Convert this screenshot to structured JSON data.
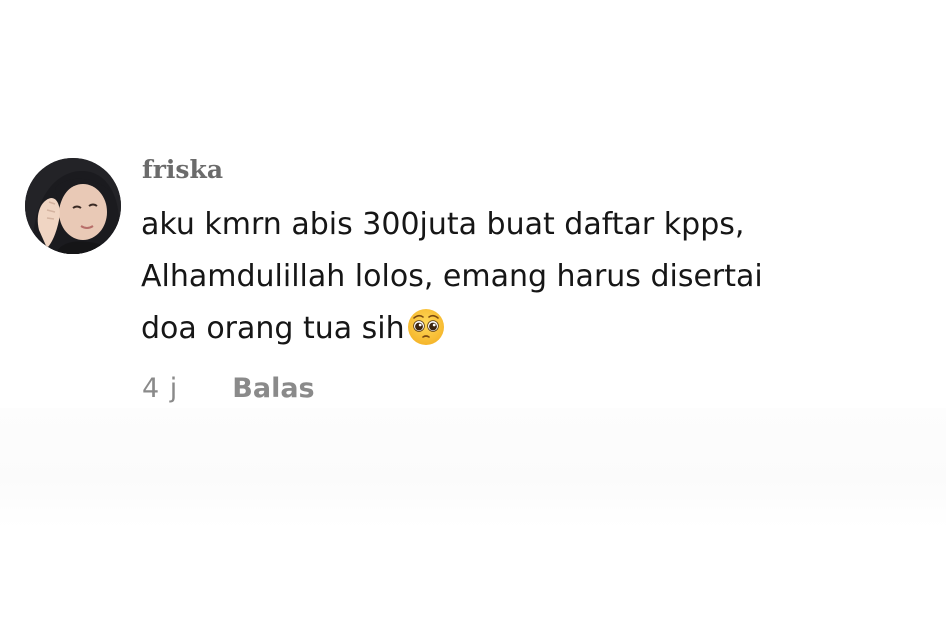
{
  "comment": {
    "username": "friska",
    "text_lines": [
      "aku kmrn abis 300juta buat daftar kpps,",
      "Alhamdulillah lolos, emang harus disertai",
      "doa orang tua sih"
    ],
    "emoji_icon": "pleading-face-icon",
    "timestamp": "4 j",
    "reply_label": "Balas"
  },
  "colors": {
    "username": "#6b6b6b",
    "text": "#161616",
    "meta": "#8a8a8a",
    "background": "#ffffff"
  }
}
